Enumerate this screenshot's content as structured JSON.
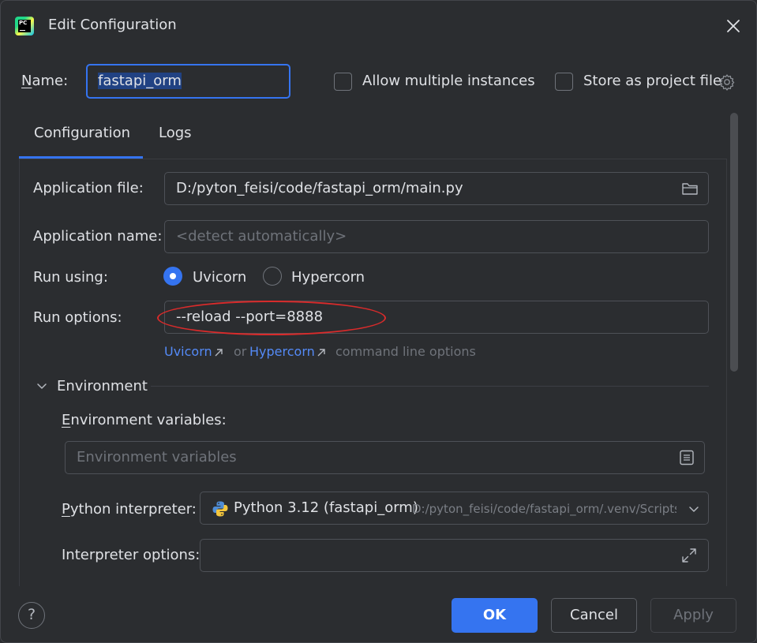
{
  "window": {
    "title": "Edit Configuration",
    "app_icon_text": "PC"
  },
  "header": {
    "name_label": "Name:",
    "name_value": "fastapi_orm",
    "allow_multiple_label": "Allow multiple instances",
    "allow_multiple_checked": false,
    "store_project_label": "Store as project file",
    "store_project_checked": false
  },
  "tabs": [
    {
      "label": "Configuration",
      "active": true
    },
    {
      "label": "Logs",
      "active": false
    }
  ],
  "config": {
    "app_file_label": "Application file:",
    "app_file_value": "D:/pyton_feisi/code/fastapi_orm/main.py",
    "app_name_label": "Application name:",
    "app_name_placeholder": "<detect automatically>",
    "run_using_label": "Run using:",
    "run_using_options": [
      {
        "label": "Uvicorn",
        "selected": true
      },
      {
        "label": "Hypercorn",
        "selected": false
      }
    ],
    "run_options_label": "Run options:",
    "run_options_value": "--reload --port=8888",
    "help_links": {
      "uvicorn": "Uvicorn",
      "or_text": "or",
      "hypercorn": "Hypercorn",
      "suffix": "command line options"
    }
  },
  "environment": {
    "section_label": "Environment",
    "env_vars_label": "Environment variables:",
    "env_vars_placeholder": "Environment variables",
    "interpreter_label": "Python interpreter:",
    "interpreter_name": "Python 3.12 (fastapi_orm)",
    "interpreter_path": "D:/pyton_feisi/code/fastapi_orm/.venv/Scripts/python.exe",
    "interpreter_options_label": "Interpreter options:",
    "interpreter_options_value": ""
  },
  "footer": {
    "help_label": "?",
    "ok_label": "OK",
    "cancel_label": "Cancel",
    "apply_label": "Apply"
  },
  "colors": {
    "accent": "#3574f0",
    "background": "#2b2d30",
    "annotation": "#d92b2b",
    "link": "#548af7"
  }
}
